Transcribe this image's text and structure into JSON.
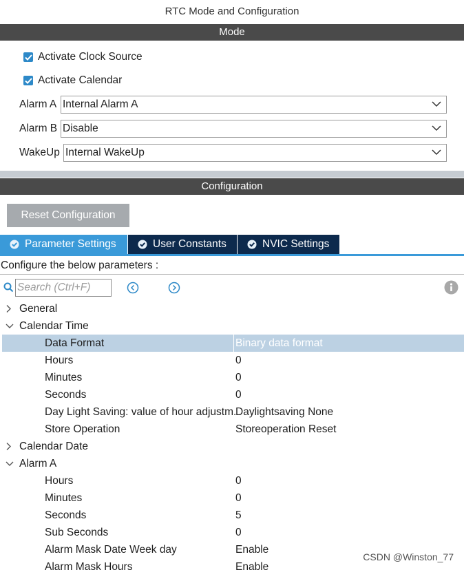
{
  "window": {
    "title": "RTC Mode and Configuration"
  },
  "mode_section": {
    "header": "Mode",
    "activate_clock_source": {
      "label": "Activate Clock Source",
      "checked": true
    },
    "activate_calendar": {
      "label": "Activate Calendar",
      "checked": true
    },
    "alarm_a": {
      "label": "Alarm A",
      "value": "Internal Alarm A"
    },
    "alarm_b": {
      "label": "Alarm B",
      "value": "Disable"
    },
    "wakeup": {
      "label": "WakeUp",
      "value": "Internal WakeUp"
    }
  },
  "configuration_section": {
    "header": "Configuration",
    "reset_button": "Reset Configuration",
    "tabs": [
      {
        "label": "Parameter Settings",
        "active": true
      },
      {
        "label": "User Constants",
        "active": false
      },
      {
        "label": "NVIC Settings",
        "active": false
      }
    ],
    "instruction": "Configure the below parameters :",
    "search_placeholder": "Search (Ctrl+F)"
  },
  "tree": {
    "general": {
      "label": "General",
      "expanded": false
    },
    "calendar_time": {
      "label": "Calendar Time",
      "expanded": true,
      "params": [
        {
          "name": "Data Format",
          "value": "Binary data format",
          "selected": true
        },
        {
          "name": "Hours",
          "value": "0"
        },
        {
          "name": "Minutes",
          "value": "0"
        },
        {
          "name": "Seconds",
          "value": "0"
        },
        {
          "name": "Day Light Saving: value of hour adjustm.",
          "value": "Daylightsaving None"
        },
        {
          "name": "Store Operation",
          "value": "Storeoperation Reset"
        }
      ]
    },
    "calendar_date": {
      "label": "Calendar Date",
      "expanded": false
    },
    "alarm_a": {
      "label": "Alarm A",
      "expanded": true,
      "params": [
        {
          "name": "Hours",
          "value": "0"
        },
        {
          "name": "Minutes",
          "value": "0"
        },
        {
          "name": "Seconds",
          "value": "5"
        },
        {
          "name": "Sub Seconds",
          "value": "0"
        },
        {
          "name": "Alarm Mask Date Week day",
          "value": "Enable"
        },
        {
          "name": "Alarm Mask Hours",
          "value": "Enable"
        }
      ]
    }
  },
  "watermark": "CSDN @Winston_77",
  "colors": {
    "section_bar": "#4a4a4a",
    "active_tab": "#3a9ad9",
    "inactive_tab": "#0d2a4d",
    "checkbox": "#2d89c8",
    "selected_row": "#bcd1e3"
  }
}
